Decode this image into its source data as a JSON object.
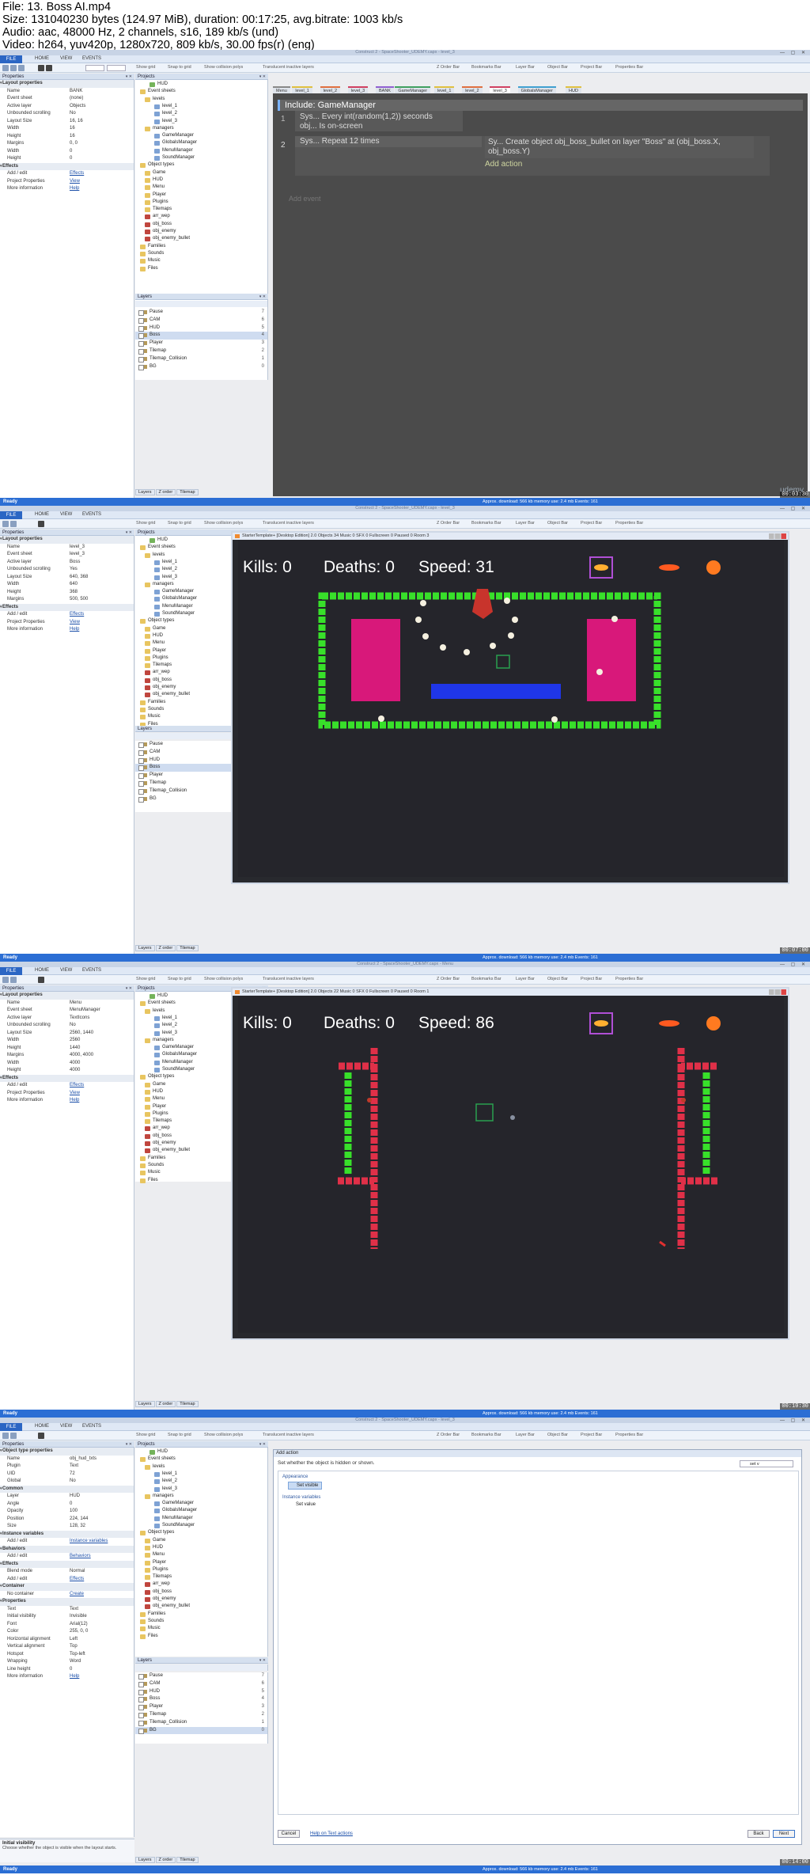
{
  "file_info": {
    "line1": "File: 13. Boss AI.mp4",
    "line2": "Size: 131040230 bytes (124.97 MiB), duration: 00:17:25, avg.bitrate: 1003 kb/s",
    "line3": "Audio: aac, 48000 Hz, 2 channels, s16, 189 kb/s (und)",
    "line4": "Video: h264, yuv420p, 1280x720, 809 kb/s, 30.00 fps(r) (eng)"
  },
  "app": {
    "ribbon": [
      "FILE",
      "HOME",
      "VIEW",
      "EVENTS"
    ],
    "options": [
      "Show grid",
      "Snap to grid",
      "Show collision polys",
      "Translucent inactive layers",
      "Z Order Bar",
      "Bookmarks Bar",
      "Layer Bar",
      "Object Bar",
      "Project Bar",
      "Properties Bar"
    ],
    "properties_header": "Properties",
    "projects_header": "Projects",
    "layers_header": "Layers",
    "bottom_tabs": [
      "Layers",
      "Z order",
      "Tilemap"
    ],
    "status_ready": "Ready",
    "status_download": "Approx. download: 566 kb  memory use: 2.4 mb  Events: 161",
    "watermark": "udemy"
  },
  "project_tree": {
    "hud": "HUD",
    "event_sheets": "Event sheets",
    "levels": "levels",
    "level_items": [
      "level_1",
      "level_2",
      "level_3"
    ],
    "managers": "managers",
    "manager_items": [
      "GameManager",
      "GlobalsManager",
      "MenuManager",
      "SoundManager"
    ],
    "object_types": "Object types",
    "object_folders": [
      "Game",
      "HUD",
      "Menu",
      "Player",
      "Plugins",
      "Tilemaps"
    ],
    "objects": [
      "arr_wep",
      "obj_boss",
      "obj_enemy",
      "obj_enemy_bullet"
    ],
    "bottom": [
      "Families",
      "Sounds",
      "Music",
      "Files"
    ]
  },
  "layers": [
    {
      "name": "Pause",
      "n": "7"
    },
    {
      "name": "CAM",
      "n": "6"
    },
    {
      "name": "HUD",
      "n": "5"
    },
    {
      "name": "Boss",
      "n": "4"
    },
    {
      "name": "Player",
      "n": "3"
    },
    {
      "name": "Tilemap",
      "n": "2"
    },
    {
      "name": "Tilemap_Collision",
      "n": "1"
    },
    {
      "name": "BG",
      "n": "0"
    }
  ],
  "frame1": {
    "timestamp": "00:03:30",
    "props": [
      {
        "k": "Layout properties",
        "sec": true
      },
      {
        "k": "Name",
        "v": "BANK"
      },
      {
        "k": "Event sheet",
        "v": "(none)"
      },
      {
        "k": "Active layer",
        "v": "Objects"
      },
      {
        "k": "Unbounded scrolling",
        "v": "No"
      },
      {
        "k": "Layout Size",
        "v": "16, 16"
      },
      {
        "k": "Width",
        "v": "16"
      },
      {
        "k": "Height",
        "v": "16"
      },
      {
        "k": "Margins",
        "v": "0, 0"
      },
      {
        "k": "Width",
        "v": "0"
      },
      {
        "k": "Height",
        "v": "0"
      },
      {
        "k": "Effects",
        "sec": true
      },
      {
        "k": "Add / edit",
        "v": "Effects",
        "link": true
      },
      {
        "k": "Project Properties",
        "v": "View",
        "link": true
      },
      {
        "k": "More information",
        "v": "Help",
        "link": true
      }
    ],
    "tabs": [
      "Menu",
      "level_1",
      "level_2",
      "level_3",
      "BANK",
      "GameManager",
      "level_1",
      "level_2",
      "level_3",
      "GlobalsManager",
      "HUD"
    ],
    "include": "Include: GameManager",
    "event1_line1": "Sys... Every int(random(1,2)) seconds",
    "event1_line2": "obj... Is on-screen",
    "event1_num": "1",
    "event2_num": "2",
    "event2_cond": "Sys... Repeat 12 times",
    "event2_action": "Sy... Create object  obj_boss_bullet on layer \"Boss\" at (obj_boss.X, obj_boss.Y)",
    "add_action": "Add action",
    "add_event": "Add event"
  },
  "frame2": {
    "timestamp": "00:07:00",
    "props": [
      {
        "k": "Layout properties",
        "sec": true
      },
      {
        "k": "Name",
        "v": "level_3"
      },
      {
        "k": "Event sheet",
        "v": "level_3"
      },
      {
        "k": "Active layer",
        "v": "Boss"
      },
      {
        "k": "Unbounded scrolling",
        "v": "Yes"
      },
      {
        "k": "Layout Size",
        "v": "640, 368"
      },
      {
        "k": "Width",
        "v": "640"
      },
      {
        "k": "Height",
        "v": "368"
      },
      {
        "k": "Margins",
        "v": "500, 500"
      },
      {
        "k": "Effects",
        "sec": true
      },
      {
        "k": "Add / edit",
        "v": "Effects",
        "link": true
      },
      {
        "k": "Project Properties",
        "v": "View",
        "link": true
      },
      {
        "k": "More information",
        "v": "Help",
        "link": true
      }
    ],
    "window_title": "StarterTemplate+ [Desktop Edition] 2.0  Objects 34  Music 0  SFX 0  Fullscreen 0  Paused 0  Room 3",
    "kills": "Kills: 0",
    "deaths": "Deaths: 0",
    "speed": "Speed: 31"
  },
  "frame3": {
    "timestamp": "00:10:30",
    "props": [
      {
        "k": "Layout properties",
        "sec": true
      },
      {
        "k": "Name",
        "v": "Menu"
      },
      {
        "k": "Event sheet",
        "v": "MenuManager"
      },
      {
        "k": "Active layer",
        "v": "TextIcons"
      },
      {
        "k": "Unbounded scrolling",
        "v": "No"
      },
      {
        "k": "Layout Size",
        "v": "2560, 1440"
      },
      {
        "k": "Width",
        "v": "2560"
      },
      {
        "k": "Height",
        "v": "1440"
      },
      {
        "k": "Margins",
        "v": "4000, 4000"
      },
      {
        "k": "Width",
        "v": "4000"
      },
      {
        "k": "Height",
        "v": "4000"
      },
      {
        "k": "Effects",
        "sec": true
      },
      {
        "k": "Add / edit",
        "v": "Effects",
        "link": true
      },
      {
        "k": "Project Properties",
        "v": "View",
        "link": true
      },
      {
        "k": "More information",
        "v": "Help",
        "link": true
      }
    ],
    "window_title": "StarterTemplate+ [Desktop Edition] 2.0  Objects 22  Music 0  SFX 0  Fullscreen 0  Paused 0  Room 1",
    "kills": "Kills: 0",
    "deaths": "Deaths: 0",
    "speed": "Speed: 86"
  },
  "frame4": {
    "timestamp": "00:14:00",
    "props": [
      {
        "k": "Object type properties",
        "sec": true
      },
      {
        "k": "Name",
        "v": "obj_hud_txts"
      },
      {
        "k": "Plugin",
        "v": "Text"
      },
      {
        "k": "UID",
        "v": "72"
      },
      {
        "k": "Global",
        "v": "No"
      },
      {
        "k": "Common",
        "sec": true
      },
      {
        "k": "Layer",
        "v": "HUD"
      },
      {
        "k": "Angle",
        "v": "0"
      },
      {
        "k": "Opacity",
        "v": "100"
      },
      {
        "k": "Position",
        "v": "224, 144"
      },
      {
        "k": "Size",
        "v": "128, 32"
      },
      {
        "k": "Instance variables",
        "sec": true
      },
      {
        "k": "Add / edit",
        "v": "Instance variables",
        "link": true
      },
      {
        "k": "Behaviors",
        "sec": true
      },
      {
        "k": "Add / edit",
        "v": "Behaviors",
        "link": true
      },
      {
        "k": "Effects",
        "sec": true
      },
      {
        "k": "Blend mode",
        "v": "Normal"
      },
      {
        "k": "Add / edit",
        "v": "Effects",
        "link": true
      },
      {
        "k": "Container",
        "sec": true
      },
      {
        "k": "No container",
        "v": "Create",
        "link": true
      },
      {
        "k": "Properties",
        "sec": true
      },
      {
        "k": "Text",
        "v": "Text"
      },
      {
        "k": "Initial visibility",
        "v": "Invisible"
      },
      {
        "k": "Font",
        "v": "Arial(12)"
      },
      {
        "k": "Color",
        "v": "255, 0, 0"
      },
      {
        "k": "Horizontal alignment",
        "v": "Left"
      },
      {
        "k": "Vertical alignment",
        "v": "Top"
      },
      {
        "k": "Hotspot",
        "v": "Top-left"
      },
      {
        "k": "Wrapping",
        "v": "Word"
      },
      {
        "k": "Line height",
        "v": "0"
      },
      {
        "k": "More information",
        "v": "Help",
        "link": true
      }
    ],
    "help_title": "Initial visibility",
    "help_text": "Choose whether the object is visible when the layout starts.",
    "dialog_title": "Add action",
    "dialog_desc": "Set whether the object is hidden or shown.",
    "search_value": "set v",
    "cat_appearance": "Appearance",
    "set_visible": "Set visible",
    "cat_instance": "Instance variables",
    "set_value": "Set value",
    "btn_cancel": "Cancel",
    "help_link": "Help on Text actions",
    "btn_back": "Back",
    "btn_next": "Next"
  }
}
